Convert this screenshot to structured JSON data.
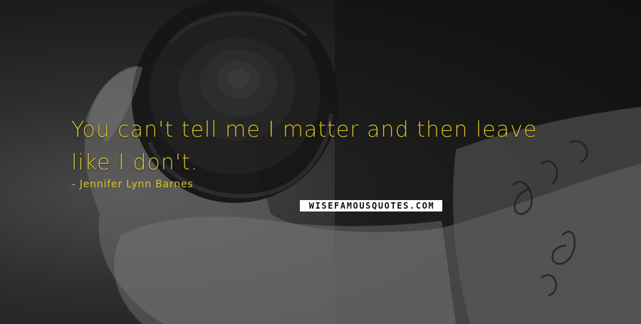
{
  "quote": {
    "text": "You can't tell me I matter and then leave like I don't."
  },
  "author": {
    "icon": "dash-icon",
    "name": "Jennifer Lynn Barnes"
  },
  "watermark": {
    "text": "WISEFAMOUSQUOTES.COM"
  },
  "colors": {
    "text": "#d8c224",
    "background": "#1a1a1a"
  }
}
